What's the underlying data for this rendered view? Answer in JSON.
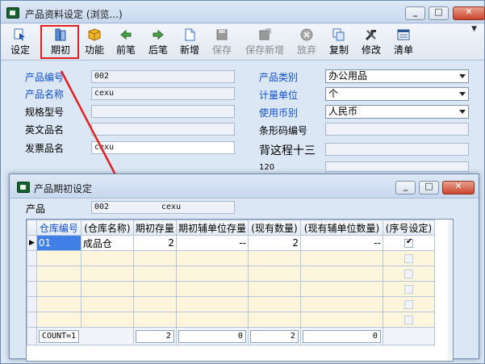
{
  "main": {
    "title": "产品资料设定 (浏览...)",
    "toolbar": [
      {
        "label": "设定",
        "icon": "cursor-icon",
        "disabled": false
      },
      {
        "label": "期初",
        "icon": "stack-icon",
        "disabled": false
      },
      {
        "label": "功能",
        "icon": "box-icon",
        "disabled": false
      },
      {
        "label": "前笔",
        "icon": "arrow-left-icon",
        "disabled": false
      },
      {
        "label": "后笔",
        "icon": "arrow-right-icon",
        "disabled": false
      },
      {
        "label": "新增",
        "icon": "new-document-icon",
        "disabled": false
      },
      {
        "label": "保存",
        "icon": "save-icon",
        "disabled": true
      },
      {
        "label": "保存新增",
        "icon": "save-new-icon",
        "disabled": true
      },
      {
        "label": "放弃",
        "icon": "cancel-icon",
        "disabled": true
      },
      {
        "label": "复制",
        "icon": "copy-icon",
        "disabled": false
      },
      {
        "label": "修改",
        "icon": "edit-tools-icon",
        "disabled": false
      },
      {
        "label": "清单",
        "icon": "list-icon",
        "disabled": false
      }
    ],
    "form": {
      "product_code_label": "产品编号",
      "product_code": "002",
      "product_name_label": "产品名称",
      "product_name": "cexu",
      "spec_label": "规格型号",
      "spec": "",
      "english_name_label": "英文品名",
      "english_name": "",
      "invoice_name_label": "发票品名",
      "invoice_name": "cexu",
      "category_label": "产品类别",
      "category": "办公用品",
      "unit_label": "计量单位",
      "unit": "个",
      "currency_label": "使用币别",
      "currency": "人民币",
      "barcode_label": "条形码编号",
      "barcode": "",
      "extra_label": "背这程十三",
      "extra_value": "120"
    }
  },
  "sub": {
    "title": "产品期初设定",
    "product_label": "产品",
    "product_code": "002",
    "product_name": "cexu",
    "columns": [
      "仓库编号",
      "(仓库名称)",
      "期初存量",
      "期初辅单位存量",
      "(现有数量)",
      "(现有辅单位数量)",
      "(序号设定)"
    ],
    "rows": [
      {
        "warehouse_code": "01",
        "warehouse_name": "成品仓",
        "opening_qty": "2",
        "opening_aux_qty": "--",
        "current_qty": "2",
        "current_aux_qty": "--",
        "serial": true
      }
    ],
    "footer": {
      "count": "COUNT=1",
      "opening_qty_total": "2",
      "opening_aux_total": "0",
      "current_qty_total": "2",
      "current_aux_total": "0"
    }
  },
  "colors": {
    "blue_label": "#1050c8",
    "highlight_red": "#e02020",
    "row_fill": "#fdf6dc"
  }
}
